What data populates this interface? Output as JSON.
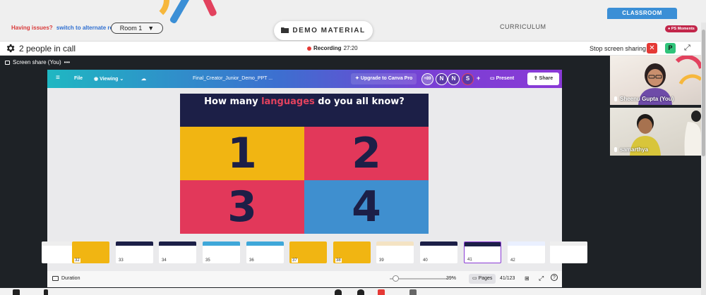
{
  "banner": {
    "issues_text": "Having issues?",
    "alternate_link": "switch to alternate room",
    "room_select": "Room 1",
    "demo_material": "DEMO MATERIAL",
    "curriculum": "CURRICULUM",
    "classroom_tab": "CLASSROOM",
    "moments_badge": "PS Moments"
  },
  "callbar": {
    "people": "2 people in call",
    "recording_label": "Recording",
    "recording_time": "27:20",
    "stop_sharing": "Stop screen sharing",
    "close_icon": "x-icon",
    "participant_badge": "P"
  },
  "stage": {
    "screen_share_label": "Screen share (You)",
    "more": "•••"
  },
  "canva": {
    "menu_icon": "hamburger-icon",
    "file": "File",
    "viewing": "Viewing",
    "doc_title": "Final_Creator_Junior_Demo_PPT ...",
    "upgrade": "Upgrade to Canva Pro",
    "avatar_count": "+89",
    "avatars": [
      "N",
      "N",
      "S"
    ],
    "plus": "+",
    "present": "Present",
    "share": "Share",
    "slide": {
      "title_a": "How many ",
      "title_highlight": "languages",
      "title_b": " do you all know?",
      "options": [
        {
          "label": "1",
          "color": "#f1b512"
        },
        {
          "label": "2",
          "color": "#e2385a"
        },
        {
          "label": "3",
          "color": "#e2385a"
        },
        {
          "label": "4",
          "color": "#3f8fcf"
        }
      ]
    },
    "thumbnails": [
      {
        "num": "",
        "color": "#eeeeee"
      },
      {
        "num": "32",
        "color": "#f1b512"
      },
      {
        "num": "33",
        "color": "#1c1f47"
      },
      {
        "num": "34",
        "color": "#1c1f47"
      },
      {
        "num": "35",
        "color": "#3fa7d9"
      },
      {
        "num": "36",
        "color": "#3fa7d9"
      },
      {
        "num": "37",
        "color": "#f1b512"
      },
      {
        "num": "38",
        "color": "#f1b512"
      },
      {
        "num": "39",
        "color": "#f4e3c3"
      },
      {
        "num": "40",
        "color": "#1c1f47"
      },
      {
        "num": "41",
        "color": "#1c1f47"
      },
      {
        "num": "42",
        "color": "#eaf0ff"
      },
      {
        "num": "",
        "color": "#eeeeee"
      }
    ],
    "footer": {
      "duration": "Duration",
      "zoom": "39%",
      "pages": "Pages",
      "page_count": "41/123"
    }
  },
  "participants": [
    {
      "name": "Sheenu Gupta (You)"
    },
    {
      "name": "samarthya"
    }
  ]
}
